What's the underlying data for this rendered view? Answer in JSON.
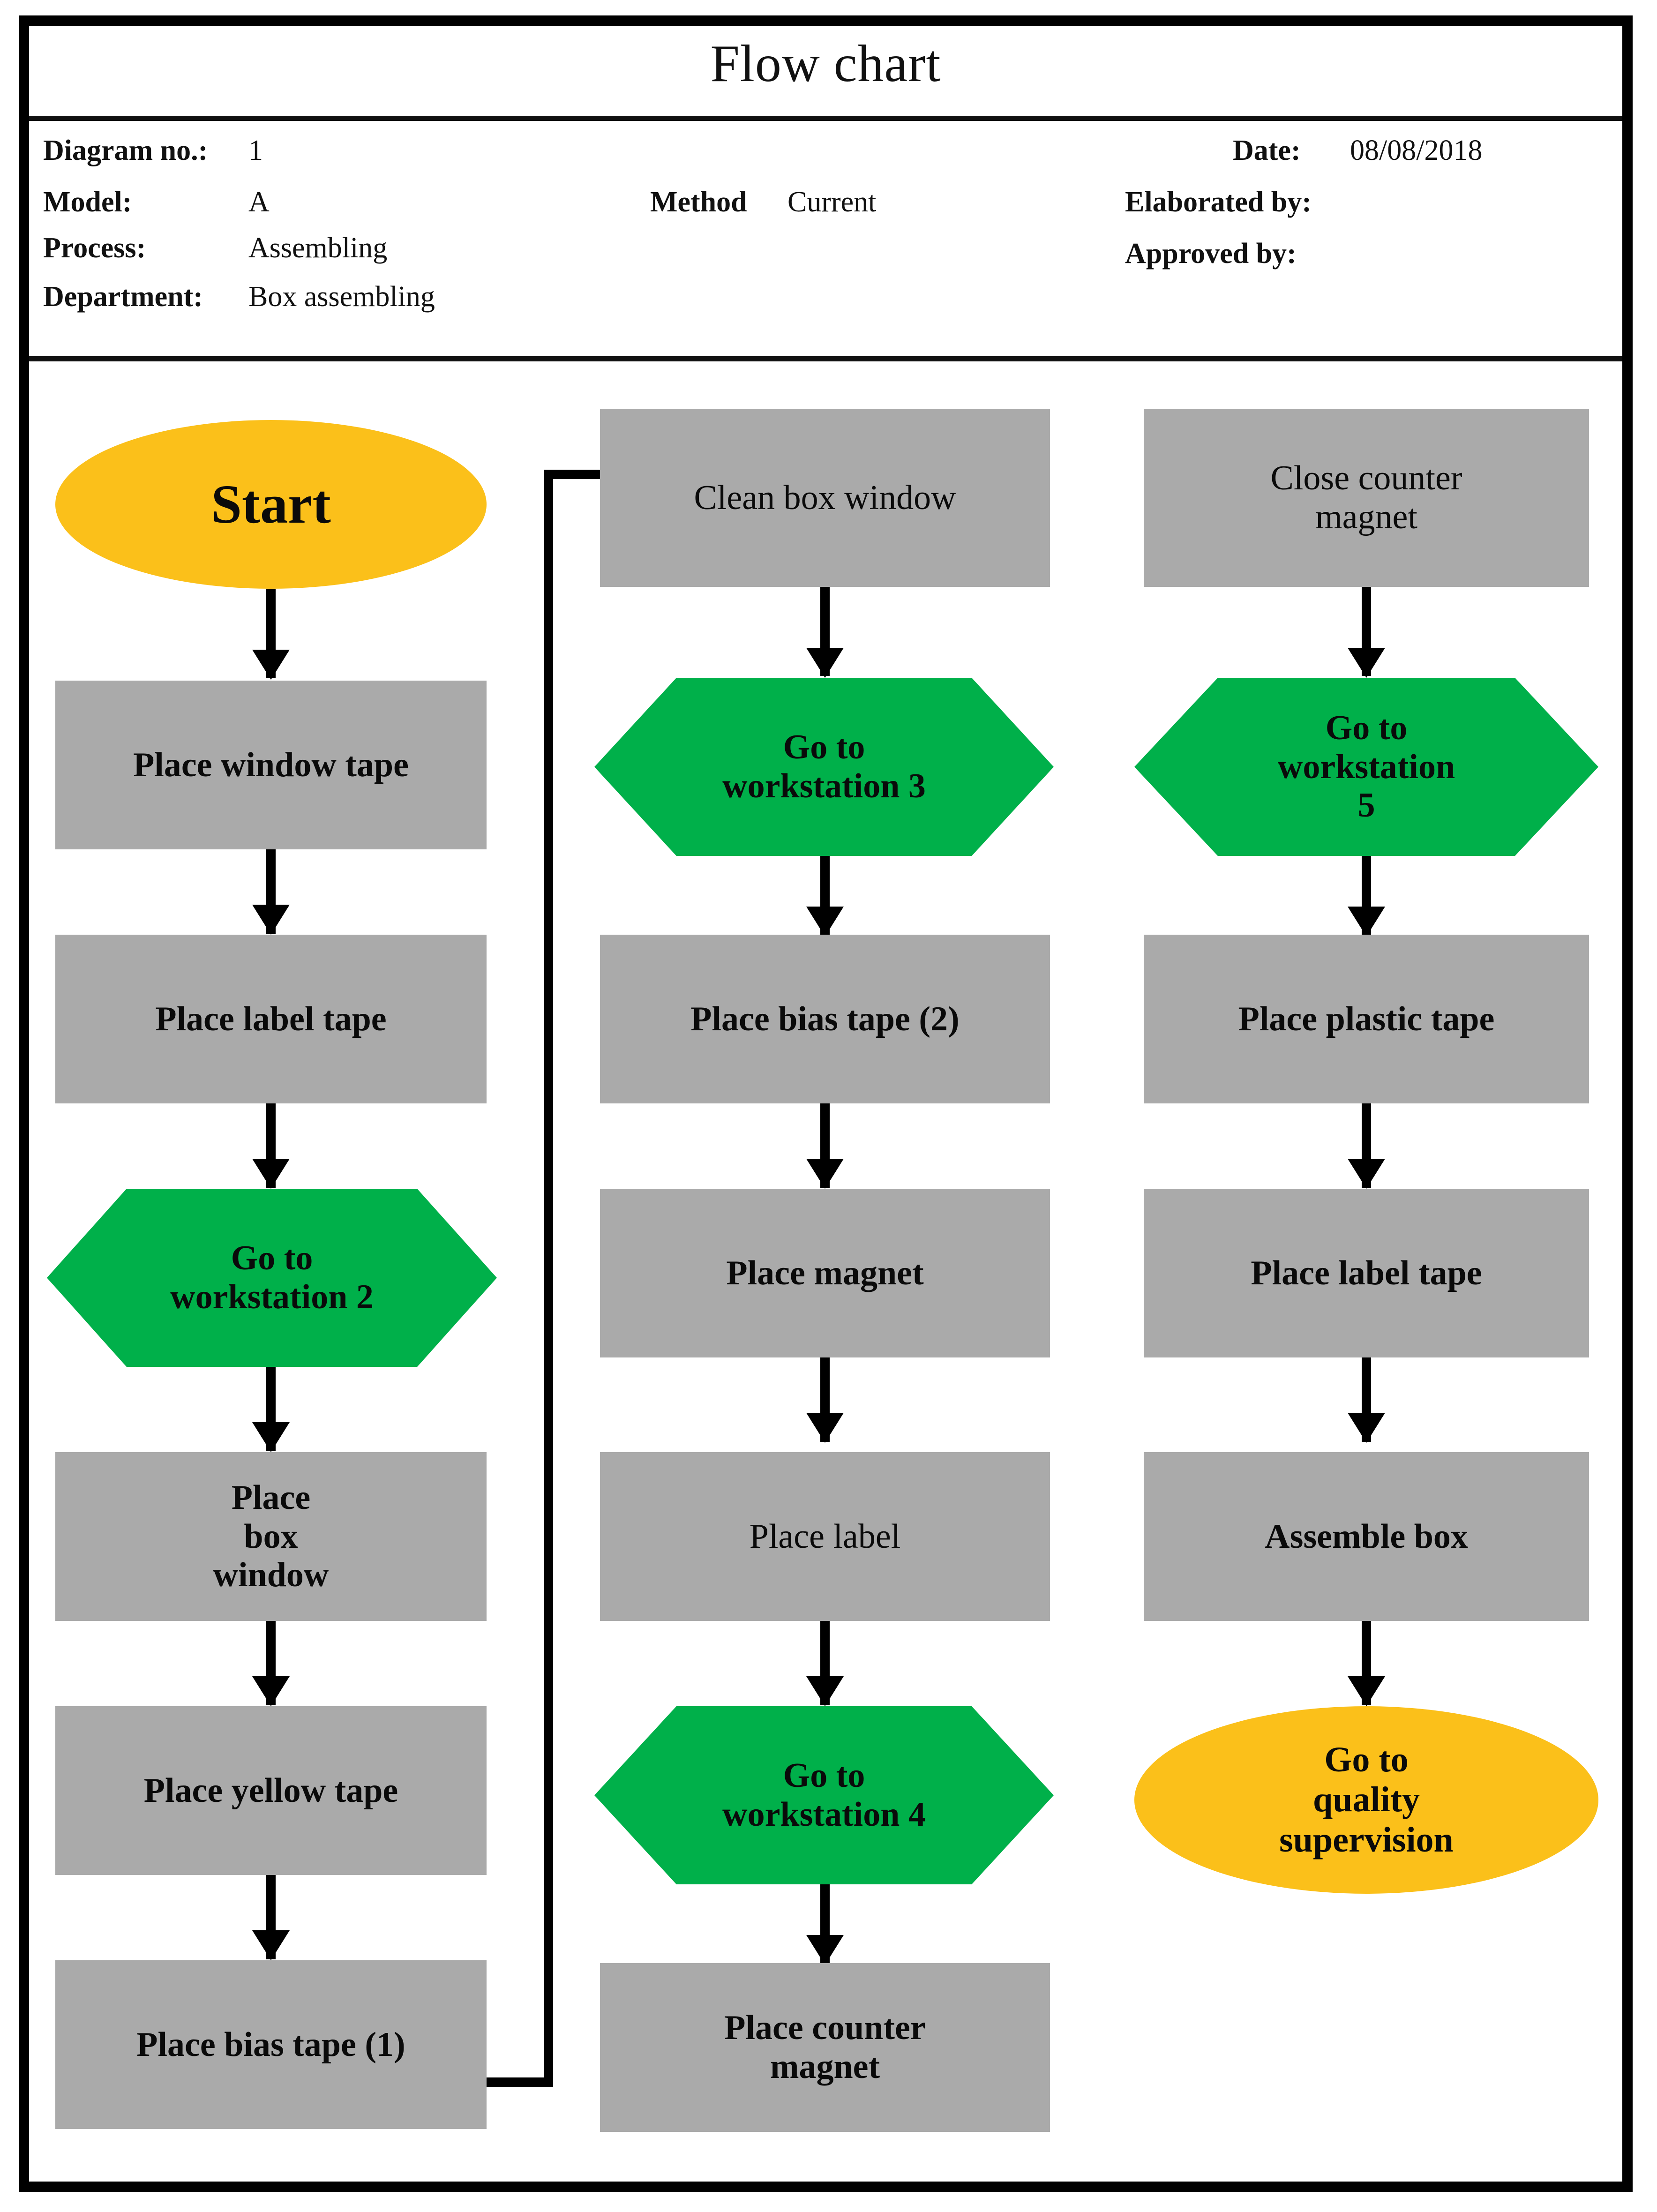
{
  "document": {
    "title": "Flow chart"
  },
  "header": {
    "left": [
      {
        "label": "Diagram no.:",
        "value": "1"
      },
      {
        "label": "Model:",
        "value": "A"
      },
      {
        "label": "Process:",
        "value": "Assembling"
      },
      {
        "label": "Department:",
        "value": "Box assembling"
      }
    ],
    "middle": {
      "label": "Method",
      "value": "Current"
    },
    "right": [
      {
        "label": "Date:",
        "value": "08/08/2018"
      },
      {
        "label": "Elaborated by:",
        "value": ""
      },
      {
        "label": "Approved by:",
        "value": ""
      }
    ]
  },
  "colors": {
    "terminator": "#FBC01A",
    "process": "#AAAAAA",
    "transport": "#00B04A",
    "connector": "#000000",
    "frame": "#000000"
  },
  "chart_data": {
    "type": "flowchart",
    "title": "Flow chart",
    "legend_shapes": {
      "oval": "terminator",
      "rectangle": "operation",
      "hexagon": "transport / move"
    },
    "columns": [
      {
        "name": "column-1",
        "nodes": [
          {
            "id": "n1",
            "text": "Start",
            "shape": "oval"
          },
          {
            "id": "n2",
            "text": "Place window tape",
            "shape": "rectangle"
          },
          {
            "id": "n3",
            "text": "Place label tape",
            "shape": "rectangle"
          },
          {
            "id": "n4",
            "text": "Go to\nworkstation 2",
            "shape": "hexagon"
          },
          {
            "id": "n5",
            "text": "Place\nbox\nwindow",
            "shape": "rectangle"
          },
          {
            "id": "n6",
            "text": "Place yellow tape",
            "shape": "rectangle"
          },
          {
            "id": "n7",
            "text": "Place bias tape (1)",
            "shape": "rectangle"
          }
        ]
      },
      {
        "name": "column-2",
        "nodes": [
          {
            "id": "n8",
            "text": "Clean box window",
            "shape": "rectangle"
          },
          {
            "id": "n9",
            "text": "Go to\nworkstation 3",
            "shape": "hexagon"
          },
          {
            "id": "n10",
            "text": "Place bias tape (2)",
            "shape": "rectangle"
          },
          {
            "id": "n11",
            "text": "Place magnet",
            "shape": "rectangle"
          },
          {
            "id": "n12",
            "text": "Place label",
            "shape": "rectangle"
          },
          {
            "id": "n13",
            "text": "Go to\nworkstation 4",
            "shape": "hexagon"
          },
          {
            "id": "n14",
            "text": "Place counter\nmagnet",
            "shape": "rectangle"
          }
        ]
      },
      {
        "name": "column-3",
        "nodes": [
          {
            "id": "n15",
            "text": "Close counter\nmagnet",
            "shape": "rectangle"
          },
          {
            "id": "n16",
            "text": "Go to\nworkstation\n5",
            "shape": "hexagon"
          },
          {
            "id": "n17",
            "text": "Place plastic tape",
            "shape": "rectangle"
          },
          {
            "id": "n18",
            "text": "Place label tape",
            "shape": "rectangle"
          },
          {
            "id": "n19",
            "text": "Assemble box",
            "shape": "rectangle"
          },
          {
            "id": "n20",
            "text": "Go to\nquality\nsupervision",
            "shape": "oval"
          }
        ]
      }
    ],
    "edges": [
      {
        "from": "n1",
        "to": "n2",
        "type": "down"
      },
      {
        "from": "n2",
        "to": "n3",
        "type": "down"
      },
      {
        "from": "n3",
        "to": "n4",
        "type": "down"
      },
      {
        "from": "n4",
        "to": "n5",
        "type": "down"
      },
      {
        "from": "n5",
        "to": "n6",
        "type": "down"
      },
      {
        "from": "n6",
        "to": "n7",
        "type": "down"
      },
      {
        "from": "n7",
        "to": "n8",
        "type": "elbow-right-up"
      },
      {
        "from": "n8",
        "to": "n9",
        "type": "down"
      },
      {
        "from": "n9",
        "to": "n10",
        "type": "down"
      },
      {
        "from": "n10",
        "to": "n11",
        "type": "down"
      },
      {
        "from": "n11",
        "to": "n12",
        "type": "down"
      },
      {
        "from": "n12",
        "to": "n13",
        "type": "down"
      },
      {
        "from": "n13",
        "to": "n14",
        "type": "down"
      },
      {
        "from": "n15",
        "to": "n16",
        "type": "down"
      },
      {
        "from": "n16",
        "to": "n17",
        "type": "down"
      },
      {
        "from": "n17",
        "to": "n18",
        "type": "down"
      },
      {
        "from": "n18",
        "to": "n19",
        "type": "down"
      },
      {
        "from": "n19",
        "to": "n20",
        "type": "down"
      }
    ]
  }
}
